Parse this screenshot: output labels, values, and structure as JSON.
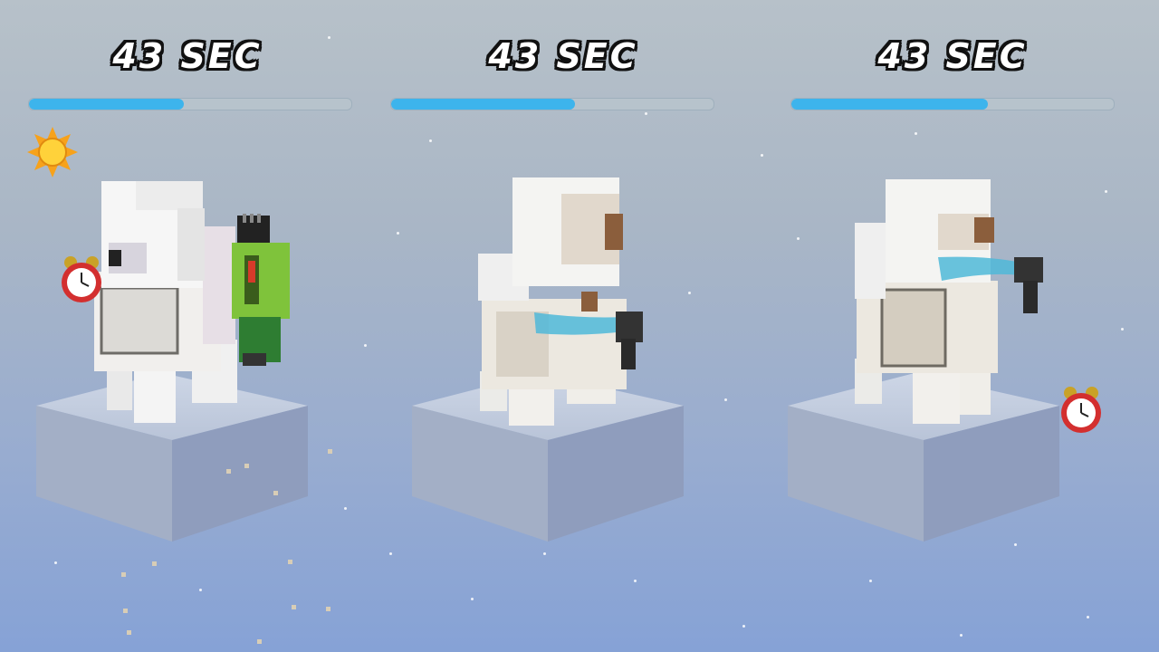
{
  "lanes": [
    {
      "timer": "43 SEC",
      "progress": 0.48,
      "tool": "green-clipper",
      "status_icon": "sun-icon",
      "state": "shaggy"
    },
    {
      "timer": "43 SEC",
      "progress": 0.57,
      "tool": "water-sprayer",
      "status_icon": "none",
      "state": "washing"
    },
    {
      "timer": "43 SEC",
      "progress": 0.61,
      "tool": "water-sprayer",
      "status_icon": "none",
      "state": "washing"
    }
  ],
  "colors": {
    "progress_fill": "#3db4ec",
    "progress_track": "#b7c3cc",
    "water": "#4fb8d8",
    "pedestal_top": "#c8d2e3",
    "pedestal_side": "#9aa8c4"
  }
}
